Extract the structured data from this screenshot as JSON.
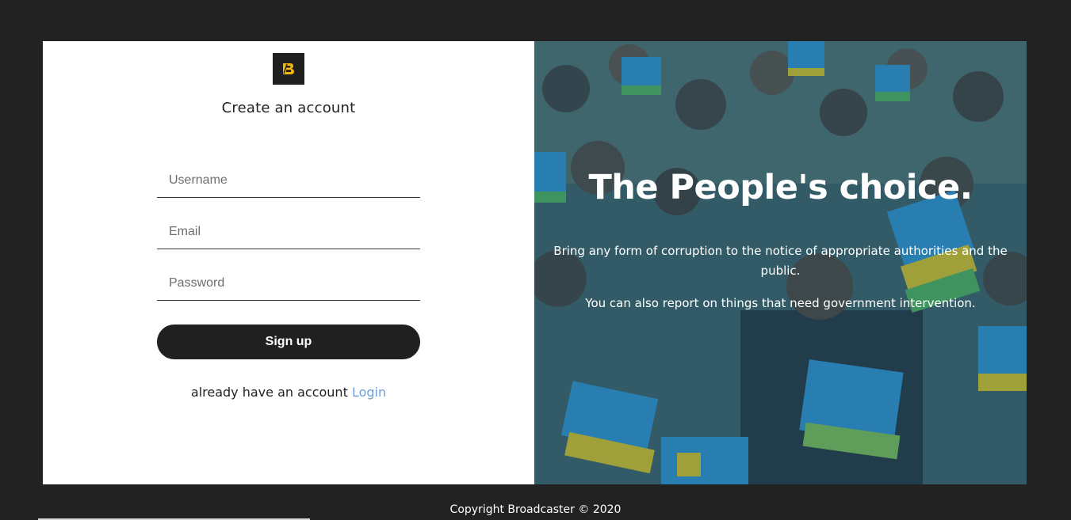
{
  "logo": {
    "glyph": "B"
  },
  "form": {
    "title": "Create an account",
    "username_placeholder": "Username",
    "email_placeholder": "Email",
    "password_placeholder": "Password",
    "signup_label": "Sign up",
    "login_prompt": "already have an account",
    "login_link": "Login"
  },
  "hero": {
    "title": "The People's choice.",
    "text1": "Bring any form of corruption to the notice of appropriate authorities and the public.",
    "text2": "You can also report on things that need government intervention."
  },
  "footer": {
    "copyright": "Copyright Broadcaster © 2020"
  },
  "colors": {
    "background": "#222222",
    "accent_yellow": "#f2b90c",
    "link_blue": "#6f9fd6",
    "button_dark": "#202020"
  }
}
